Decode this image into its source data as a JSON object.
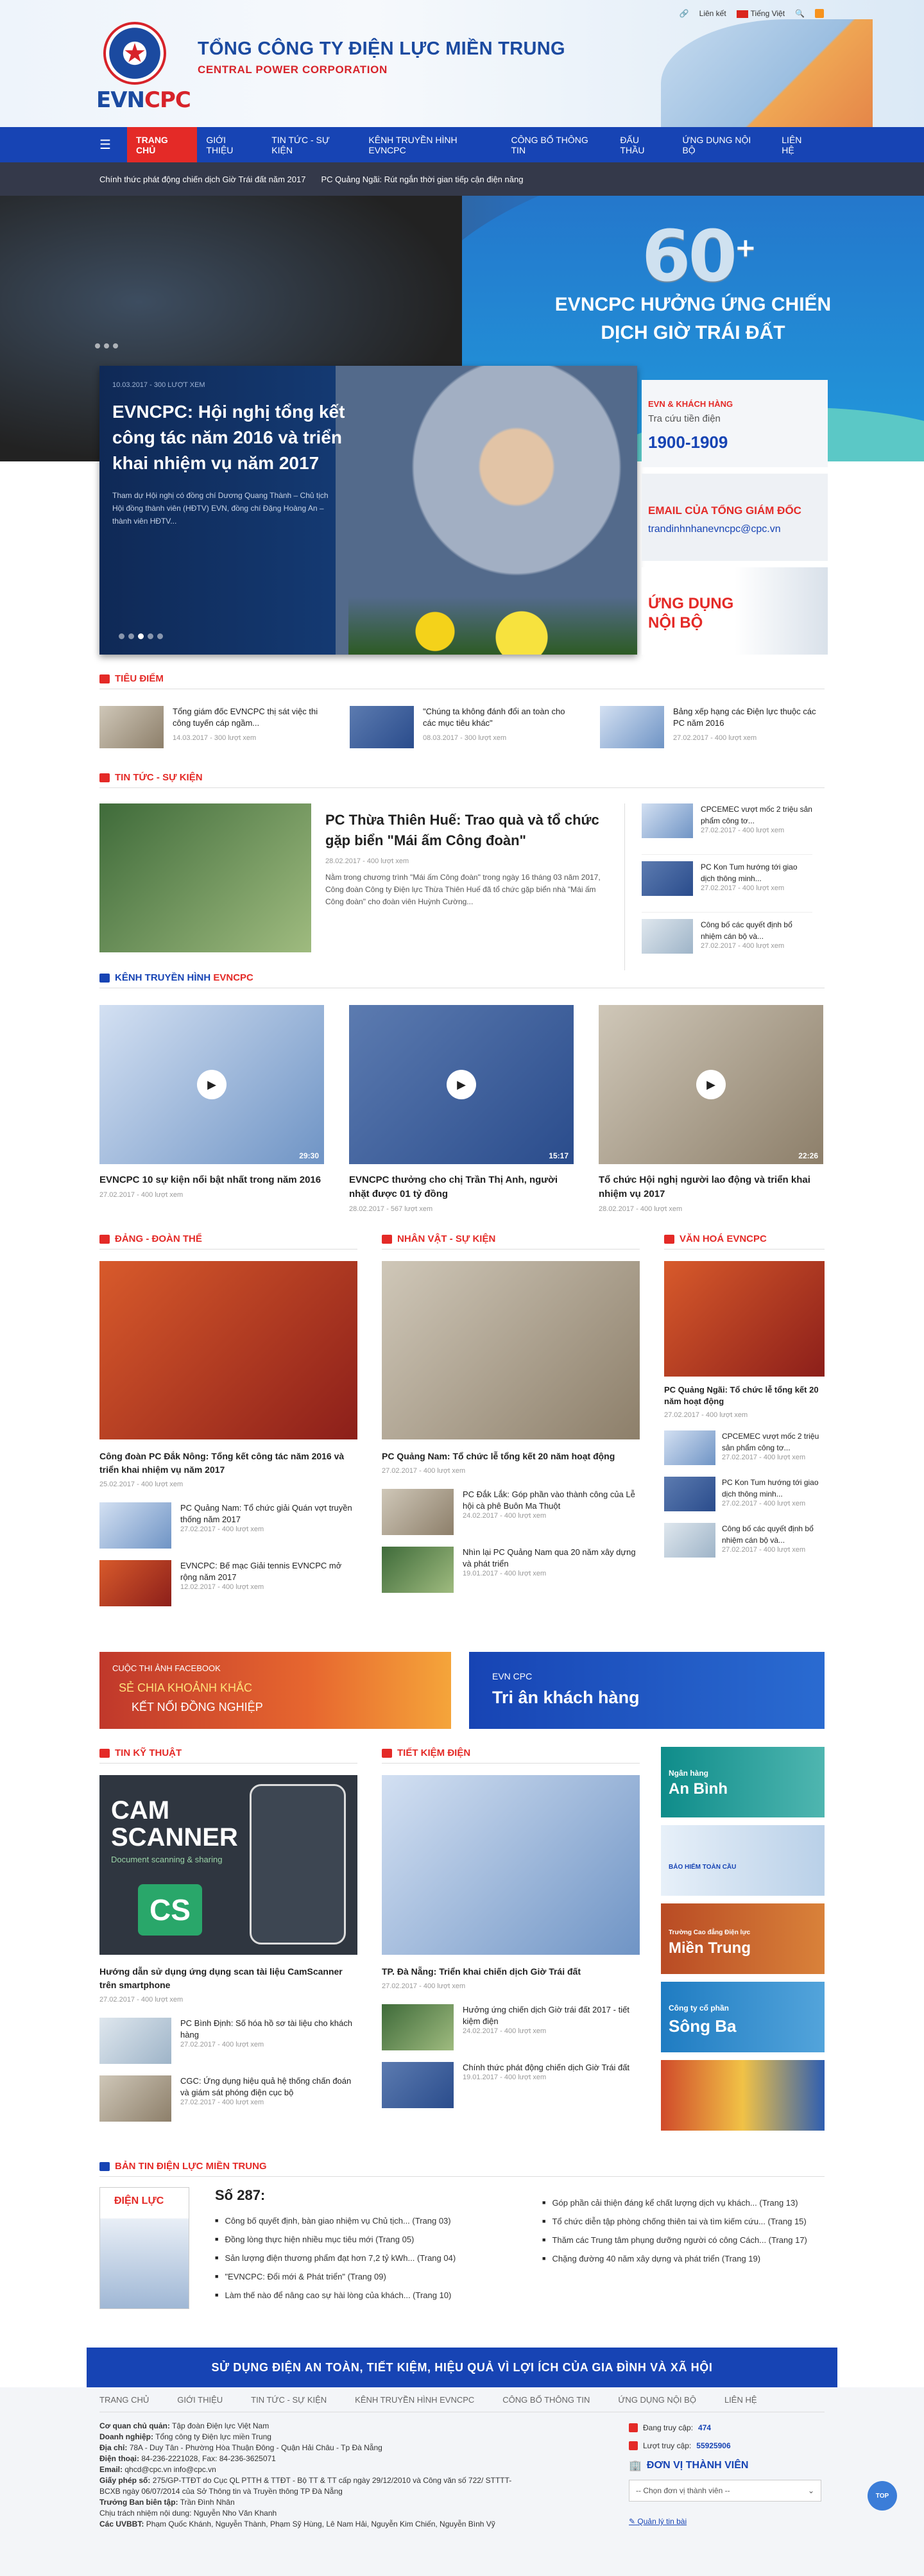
{
  "header": {
    "top_links": [
      "Liên kết",
      "Tiếng Việt"
    ],
    "title_vn": "TỔNG CÔNG TY ĐIỆN LỰC MIỀN TRUNG",
    "title_en": "CENTRAL POWER CORPORATION",
    "logo_text_a": "EVN",
    "logo_text_b": "CPC"
  },
  "nav": {
    "items": [
      "TRANG CHỦ",
      "GIỚI THIỆU",
      "TIN TỨC - SỰ KIỆN",
      "KÊNH TRUYỀN HÌNH EVNCPC",
      "CÔNG BỐ THÔNG TIN",
      "ĐẤU THẦU",
      "ỨNG DỤNG NỘI BỘ",
      "LIÊN HỆ"
    ]
  },
  "ticker": [
    "Chính thức phát động chiến dịch Giờ Trái đất năm 2017",
    "PC Quảng Ngãi: Rút ngắn thời gian tiếp cận điện năng"
  ],
  "hero": {
    "big_number": "60",
    "big_plus": "+",
    "slogan": "EVNCPC HƯỞNG ỨNG CHIẾN DỊCH GIỜ TRÁI ĐẤT",
    "featured": {
      "meta": "10.03.2017 - 300 LƯỢT XEM",
      "title": "EVNCPC: Hội nghị tổng kết công tác năm 2016 và triển khai nhiệm vụ năm 2017",
      "summary": "Tham dự Hội nghị có đồng chí Dương Quang Thành – Chủ tịch Hội đồng thành viên (HĐTV) EVN, đồng chí Đặng Hoàng An – thành viên HĐTV..."
    },
    "side": {
      "b1_l1": "EVN & KHÁCH HÀNG",
      "b1_l2": "Tra cứu tiền điện",
      "b1_l3": "1900-1909",
      "b2_l1": "EMAIL CỦA TỔNG GIÁM ĐỐC",
      "b2_l2": "trandinhnhanevncpc@cpc.vn",
      "b3_l1": "ỨNG DỤNG NỘI BỘ"
    }
  },
  "tieudiem": {
    "heading": "TIÊU ĐIỂM",
    "items": [
      {
        "title": "Tổng giám đốc EVNCPC thị sát việc thi công tuyến cáp ngầm...",
        "meta": "14.03.2017 - 300 lượt xem"
      },
      {
        "title": "\"Chúng ta không đánh đổi an toàn cho các mục tiêu khác\"",
        "meta": "08.03.2017 - 300 lượt xem"
      },
      {
        "title": "Bảng xếp hạng các Điện lực thuộc các PC năm 2016",
        "meta": "27.02.2017 - 400 lượt xem"
      }
    ]
  },
  "tintuc": {
    "heading": "TIN TỨC - SỰ KIỆN",
    "main": {
      "title": "PC Thừa Thiên Huế: Trao quà và tổ chức gặp biển \"Mái ấm Công đoàn\"",
      "meta": "28.02.2017 - 400 lượt xem",
      "summary": "Nằm trong chương trình \"Mái ấm Công đoàn\" trong ngày 16 tháng 03 năm 2017, Công đoàn Công ty Điện lực Thừa Thiên Huế đã tổ chức gặp biển nhà \"Mái ấm Công đoàn\" cho đoàn viên Huỳnh Cường..."
    },
    "side": [
      {
        "title": "CPCEMEC vượt mốc 2 triệu sản phẩm công tơ...",
        "meta": "27.02.2017 - 400 lượt xem"
      },
      {
        "title": "PC Kon Tum hướng tới giao dịch thông minh...",
        "meta": "27.02.2017 - 400 lượt xem"
      },
      {
        "title": "Công bố các quyết định bổ nhiệm cán bộ và...",
        "meta": "27.02.2017 - 400 lượt xem"
      }
    ]
  },
  "tv": {
    "heading_a": "KÊNH TRUYỀN HÌNH",
    "heading_b": "EVNCPC",
    "items": [
      {
        "title": "EVNCPC 10 sự kiện nổi bật nhất trong năm 2016",
        "meta": "27.02.2017 - 400 lượt xem",
        "dur": "29:30"
      },
      {
        "title": "EVNCPC thưởng cho chị Trần Thị Anh, người nhặt được 01 tỷ đồng",
        "meta": "28.02.2017 - 567 lượt xem",
        "dur": "15:17"
      },
      {
        "title": "Tổ chức Hội nghị người lao động và triển khai nhiệm vụ 2017",
        "meta": "28.02.2017 - 400 lượt xem",
        "dur": "22:26"
      }
    ]
  },
  "dang": {
    "heading": "ĐẢNG - ĐOÀN THỂ",
    "main_title": "Công đoàn PC Đắk Nông: Tổng kết công tác năm 2016 và triển khai nhiệm vụ năm 2017",
    "main_meta": "25.02.2017 - 400 lượt xem",
    "items": [
      {
        "title": "PC Quảng Nam: Tổ chức giải Quán vợt truyền thống năm 2017",
        "meta": "27.02.2017 - 400 lượt xem"
      },
      {
        "title": "EVNCPC: Bế mạc Giải tennis EVNCPC mở rộng năm 2017",
        "meta": "12.02.2017 - 400 lượt xem"
      }
    ]
  },
  "nhanvat": {
    "heading": "NHÂN VẬT - SỰ KIỆN",
    "main_title": "PC Quảng Nam: Tổ chức lễ tổng kết 20 năm hoạt động",
    "main_meta": "27.02.2017 - 400 lượt xem",
    "items": [
      {
        "title": "PC Đắk Lắk: Góp phần vào thành công của Lễ hội cà phê Buôn Ma Thuột",
        "meta": "24.02.2017 - 400 lượt xem"
      },
      {
        "title": "Nhìn lại PC Quảng Nam qua 20 năm xây dựng và phát triển",
        "meta": "19.01.2017 - 400 lượt xem"
      }
    ]
  },
  "vanhoa": {
    "heading": "VĂN HOÁ EVNCPC",
    "main_title": "PC Quảng Ngãi: Tổ chức lễ tổng kết 20 năm hoạt động",
    "main_meta": "27.02.2017 - 400 lượt xem",
    "items": [
      {
        "title": "CPCEMEC vượt mốc 2 triệu sản phẩm công tơ...",
        "meta": "27.02.2017 - 400 lượt xem"
      },
      {
        "title": "PC Kon Tum hướng tới giao dịch thông minh...",
        "meta": "27.02.2017 - 400 lượt xem"
      },
      {
        "title": "Công bố các quyết định bổ nhiệm cán bộ và...",
        "meta": "27.02.2017 - 400 lượt xem"
      }
    ]
  },
  "banners": {
    "fb_l1": "CUỘC THI ẢNH FACEBOOK",
    "fb_l2": "SẺ CHIA KHOẢNH KHẮC",
    "fb_l3": "KẾT NỐI ĐỒNG NGHIỆP",
    "ta_l1": "EVN CPC",
    "ta_l2": "Tri ân khách hàng"
  },
  "kythuat": {
    "heading": "TIN KỸ THUẬT",
    "cam1": "CAM",
    "cam2": "SCANNER",
    "cam3": "Document scanning & sharing",
    "cam4": "CS",
    "main_title": "Hướng dẫn sử dụng ứng dụng scan tài liệu CamScanner trên smartphone",
    "main_meta": "27.02.2017 - 400 lượt xem",
    "items": [
      {
        "title": "PC Bình Định: Số hóa hồ sơ tài liệu cho khách hàng",
        "meta": "27.02.2017 - 400 lượt xem"
      },
      {
        "title": "CGC: Ứng dụng hiệu quả hệ thống chấn đoán và giám sát phóng điện cục bộ",
        "meta": "27.02.2017 - 400 lượt xem"
      }
    ]
  },
  "tietkiem": {
    "heading": "TIẾT KIỆM ĐIỆN",
    "main_title": "TP. Đà Nẵng: Triển khai chiến dịch Giờ Trái đất",
    "main_meta": "27.02.2017 - 400 lượt xem",
    "items": [
      {
        "title": "Hưởng ứng chiến dịch Giờ trái đất 2017 - tiết kiệm điện",
        "meta": "24.02.2017 - 400 lượt xem"
      },
      {
        "title": "Chính thức phát động chiến dịch Giờ Trái đất",
        "meta": "19.01.2017 - 400 lượt xem"
      }
    ]
  },
  "ads": [
    {
      "l1": "Ngân hàng",
      "l2": "An Bình"
    },
    {
      "l1": "",
      "l2": "BẢO HIỂM TOÀN CẦU"
    },
    {
      "l1": "Trường Cao đẳng Điện lực",
      "l2": "Miền Trung"
    },
    {
      "l1": "Công ty cổ phần",
      "l2": "Sông Ba"
    },
    {
      "l1": "",
      "l2": ""
    }
  ],
  "bantin": {
    "heading": "BẢN TIN ĐIỆN LỰC MIỀN TRUNG",
    "issue": "Số 287:",
    "cover_text": "ĐIỆN LỰC",
    "left": [
      "Công bố quyết định, bàn giao nhiệm vụ Chủ tịch... (Trang 03)",
      "Đồng lòng thực hiện nhiều mục tiêu mới (Trang 05)",
      "Sản lượng điện thương phẩm đạt hơn 7,2 tỷ kWh... (Trang 04)",
      "\"EVNCPC: Đổi mới & Phát triển\" (Trang 09)",
      "Làm thế nào để nâng cao sự hài lòng của khách... (Trang 10)"
    ],
    "right": [
      "Góp phần cải thiện đáng kể chất lượng dịch vụ khách... (Trang 13)",
      "Tổ chức diễn tập phòng chống thiên tai và tìm kiếm cứu... (Trang 15)",
      "Thăm các Trung tâm phụng dưỡng người có công Cách... (Trang 17)",
      "Chặng đường 40 năm xây dựng và phát triển (Trang 19)"
    ]
  },
  "footer": {
    "slogan": "SỬ DỤNG ĐIỆN AN TOÀN, TIẾT KIỆM, HIỆU QUẢ VÌ LỢI ÍCH CỦA GIA ĐÌNH VÀ XÃ HỘI",
    "nav": [
      "TRANG CHỦ",
      "GIỚI THIỆU",
      "TIN TỨC - SỰ KIỆN",
      "KÊNH TRUYỀN HÌNH EVNCPC",
      "CÔNG BỐ THÔNG TIN",
      "ỨNG DỤNG NỘI BỘ",
      "LIÊN HỆ"
    ],
    "info": [
      [
        "Cơ quan chủ quản:",
        "Tập đoàn Điện lực Việt Nam"
      ],
      [
        "Doanh nghiệp:",
        "Tổng công ty Điện lực miền Trung"
      ],
      [
        "Địa chỉ:",
        "78A - Duy Tân - Phường Hòa Thuận Đông - Quận Hải Châu - Tp Đà Nẵng"
      ],
      [
        "Điện thoại:",
        "84-236-2221028, Fax: 84-236-3625071"
      ],
      [
        "Email:",
        "qhcd@cpc.vn   info@cpc.vn"
      ],
      [
        "Giấy phép số:",
        "275/GP-TTĐT do Cục QL PTTH & TTĐT - Bộ TT & TT cấp ngày 29/12/2010 và Công văn số 722/ STTTT-BCXB ngày 06/07/2014 của Sở Thông tin và Truyền thông TP Đà Nẵng"
      ],
      [
        "Trưởng Ban biên tập:",
        "Trần Đình Nhân"
      ],
      [
        "Chịu trách nhiệm nội dung:",
        "Nguyễn Nho Văn Khanh"
      ],
      [
        "Các UVBBT:",
        "Phạm Quốc Khánh, Nguyễn Thành, Phạm Sỹ Hùng, Lê Nam Hải, Nguyễn Kim Chiến, Nguyễn Bình Vỹ"
      ]
    ],
    "stats_today_label": "Đang truy cập:",
    "stats_today": "474",
    "stats_total_label": "Lượt truy cập:",
    "stats_total": "55925906",
    "units_heading": "ĐƠN VỊ THÀNH VIÊN",
    "units_select": "-- Chọn đơn vị thành viên --",
    "quick_link": "Quản lý tin bài",
    "top": "TOP"
  }
}
